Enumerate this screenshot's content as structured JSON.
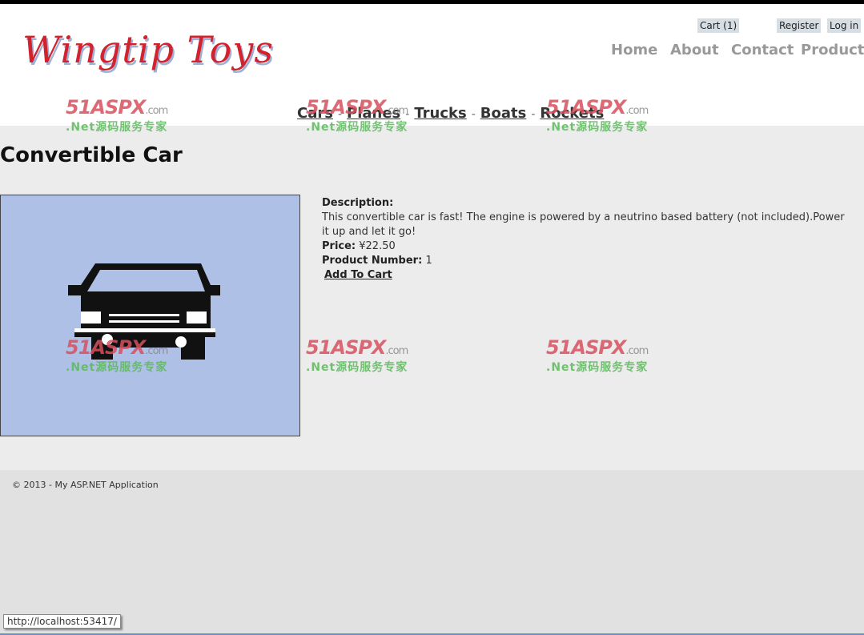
{
  "header": {
    "logo": "Wingtip Toys",
    "cart": "Cart (1)",
    "register": "Register",
    "login": "Log in",
    "nav": [
      "Home",
      "About",
      "Contact",
      "Products"
    ]
  },
  "categories": [
    "Cars",
    "Planes",
    "Trucks",
    "Boats",
    "Rockets"
  ],
  "category_separator": "-",
  "product": {
    "title": "Convertible Car",
    "description_label": "Description:",
    "description": "This convertible car is fast! The engine is powered by a neutrino based battery (not included).Power it up and let it go!",
    "price_label": "Price:",
    "price": "¥22.50",
    "number_label": "Product Number:",
    "number": "1",
    "add_to_cart": "Add To Cart"
  },
  "footer": {
    "copyright": "© 2013 - My ASP.NET Application"
  },
  "status_url": "http://localhost:53417/",
  "watermark": {
    "brand": "51ASPX",
    "suffix": ".com",
    "slogan": ".Net源码服务专家"
  }
}
